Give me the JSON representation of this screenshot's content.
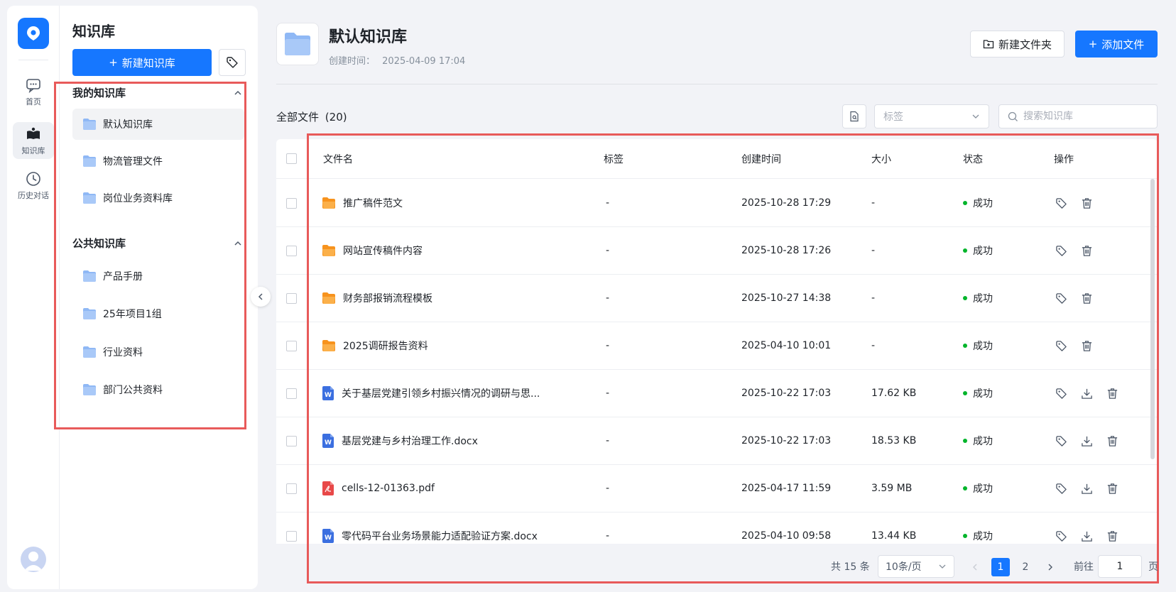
{
  "nav": {
    "items": [
      {
        "label": "首页",
        "icon": "chat-icon"
      },
      {
        "label": "知识库",
        "icon": "book-icon"
      },
      {
        "label": "历史对话",
        "icon": "clock-icon"
      }
    ]
  },
  "sidebar": {
    "title": "知识库",
    "new_button": "新建知识库",
    "my_section": "我的知识库",
    "my_items": [
      "默认知识库",
      "物流管理文件",
      "岗位业务资料库"
    ],
    "public_section": "公共知识库",
    "public_items": [
      "产品手册",
      "25年项目1组",
      "行业资料",
      "部门公共资料"
    ]
  },
  "header": {
    "title": "默认知识库",
    "created_label": "创建时间：",
    "created_value": "2025-04-09 17:04",
    "new_folder": "新建文件夹",
    "add_file": "添加文件"
  },
  "toolbar": {
    "all_files": "全部文件",
    "count": "(20)",
    "tag_placeholder": "标签",
    "search_placeholder": "搜索知识库"
  },
  "table": {
    "columns": [
      "文件名",
      "标签",
      "创建时间",
      "大小",
      "状态",
      "操作"
    ],
    "rows": [
      {
        "type": "folder",
        "name": "推广稿件范文",
        "tag": "-",
        "time": "2025-10-28 17:29",
        "size": "-",
        "status": "成功"
      },
      {
        "type": "folder",
        "name": "网站宣传稿件内容",
        "tag": "-",
        "time": "2025-10-28 17:26",
        "size": "-",
        "status": "成功"
      },
      {
        "type": "folder",
        "name": "财务部报销流程模板",
        "tag": "-",
        "time": "2025-10-27 14:38",
        "size": "-",
        "status": "成功"
      },
      {
        "type": "folder",
        "name": "2025调研报告资料",
        "tag": "-",
        "time": "2025-04-10 10:01",
        "size": "-",
        "status": "成功"
      },
      {
        "type": "word",
        "name": "关于基层党建引领乡村振兴情况的调研与思...",
        "tag": "-",
        "time": "2025-10-22 17:03",
        "size": "17.62 KB",
        "status": "成功"
      },
      {
        "type": "word",
        "name": "基层党建与乡村治理工作.docx",
        "tag": "-",
        "time": "2025-10-22 17:03",
        "size": "18.53 KB",
        "status": "成功"
      },
      {
        "type": "pdf",
        "name": "cells-12-01363.pdf",
        "tag": "-",
        "time": "2025-04-17 11:59",
        "size": "3.59 MB",
        "status": "成功"
      },
      {
        "type": "word",
        "name": "零代码平台业务场景能力适配验证方案.docx",
        "tag": "-",
        "time": "2025-04-10 09:58",
        "size": "13.44 KB",
        "status": "成功"
      }
    ]
  },
  "pagination": {
    "total": "共 15 条",
    "page_size": "10条/页",
    "pages": [
      "1",
      "2"
    ],
    "current": "1",
    "goto_label": "前往",
    "goto_value": "1",
    "page_suffix": "页"
  },
  "colors": {
    "accent": "#1677ff",
    "highlight_box": "#e85a5a",
    "folder": "#f7931e",
    "word": "#3b6fe0",
    "pdf": "#e84848",
    "success": "#00b42a"
  }
}
